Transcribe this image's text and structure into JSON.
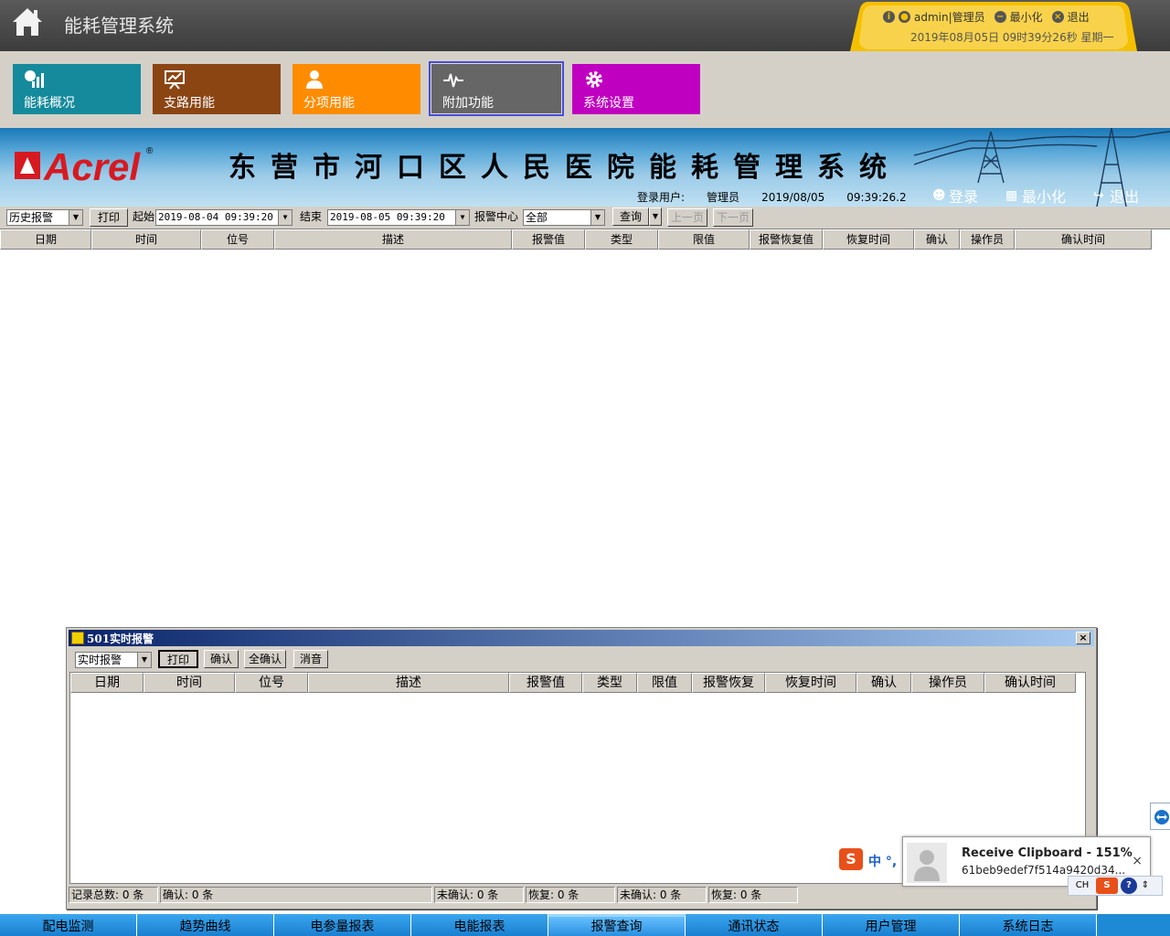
{
  "header": {
    "app_title": "能耗管理系统",
    "user": "admin|管理员",
    "minimize": "最小化",
    "logout": "退出",
    "datetime": "2019年08月05日 09时39分26秒 星期一"
  },
  "tiles": [
    {
      "label": "能耗概况",
      "icon": "chart-icon",
      "color": "#148a9c"
    },
    {
      "label": "支路用能",
      "icon": "presentation-icon",
      "color": "#8b4513"
    },
    {
      "label": "分项用能",
      "icon": "person-icon",
      "color": "#ff8c00"
    },
    {
      "label": "附加功能",
      "icon": "pulse-icon",
      "color": "#666666"
    },
    {
      "label": "系统设置",
      "icon": "gear-icon",
      "color": "#c000c0"
    }
  ],
  "banner": {
    "logo_text": "Acrel",
    "title": "东营市河口区人民医院能耗管理系统",
    "login_user_label": "登录用户:",
    "login_user": "管理员",
    "date": "2019/08/05",
    "time": "09:39:26.2",
    "login": "登录",
    "minimize": "最小化",
    "exit": "退出"
  },
  "query": {
    "mode": "历史报警",
    "print": "打印",
    "start_label": "起始",
    "start": "2019-08-04 09:39:20",
    "end_label": "结束",
    "end": "2019-08-05 09:39:20",
    "center_label": "报警中心",
    "center": "全部",
    "search": "查询",
    "prev": "上一页",
    "next": "下一页"
  },
  "main_columns": [
    "日期",
    "时间",
    "位号",
    "描述",
    "报警值",
    "类型",
    "限值",
    "报警恢复值",
    "恢复时间",
    "确认",
    "操作员",
    "确认时间"
  ],
  "alarm_window": {
    "title": "501实时报警",
    "mode": "实时报警",
    "print": "打印",
    "confirm": "确认",
    "confirm_all": "全确认",
    "mute": "消音",
    "columns": [
      "日期",
      "时间",
      "位号",
      "描述",
      "报警值",
      "类型",
      "限值",
      "报警恢复",
      "恢复时间",
      "确认",
      "操作员",
      "确认时间"
    ],
    "status": [
      "记录总数: 0 条",
      "确认: 0 条",
      "未确认: 0 条",
      "恢复: 0 条",
      "未确认: 0 条",
      "恢复: 0 条"
    ]
  },
  "bottom_nav": [
    "配电监测",
    "趋势曲线",
    "电参量报表",
    "电能报表",
    "报警查询",
    "通讯状态",
    "用户管理",
    "系统日志"
  ],
  "bottom_nav_active": "报警查询",
  "clipboard_popup": {
    "title": "Receive Clipboard - 151%",
    "text": "61beb9edef7f514a9420d34..."
  },
  "ime": {
    "logo": "S",
    "text": "中 °,"
  },
  "tray": {
    "lang": "CH"
  }
}
